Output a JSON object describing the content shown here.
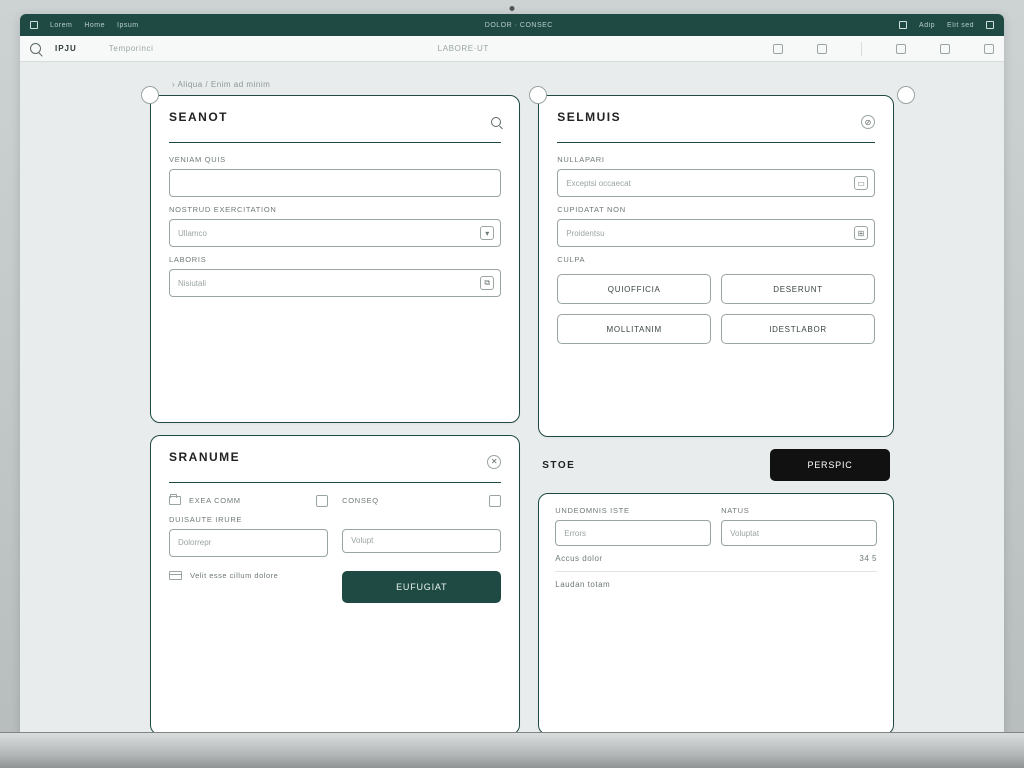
{
  "colors": {
    "accent": "#1f4a44",
    "text_muted": "#6e7977"
  },
  "tabbar": {
    "items_left": [
      "Lorem",
      "Home",
      "Ipsum"
    ],
    "center": "DOLOR · CONSEC",
    "items_right": [
      "Adip",
      "Elit sed"
    ]
  },
  "urlbar": {
    "brand": "IPJU",
    "hint_left": "Temporinci",
    "center": "LABORE·UT",
    "right_items": [
      "",
      "",
      ""
    ]
  },
  "breadcrumb": "›  Aliqua / Enim ad minim",
  "left": {
    "card1": {
      "title": "SEANOT",
      "field1": {
        "label": "VENIAM QUIS",
        "placeholder": ""
      },
      "field2": {
        "label": "NOSTRUD EXERCITATION",
        "placeholder": "Ullamco"
      },
      "field3": {
        "label": "LABORIS",
        "placeholder": "Nisiutali"
      }
    },
    "card2": {
      "title": "SRANUME",
      "row1": {
        "left_label": "EXEA COMM",
        "right_label": "CONSEQ"
      },
      "field_left": {
        "label": "DUISAUTE IRURE",
        "placeholder": "Dolorrepr"
      },
      "field_right": {
        "label": "",
        "placeholder": "Volupt"
      },
      "checkbox_label": "Velit esse cillum dolore",
      "submit_label": "EUFUGIAT"
    }
  },
  "right": {
    "card1": {
      "title": "SELMUIS",
      "field1": {
        "label": "NULLAPARI",
        "placeholder": "Exceptsi occaecat"
      },
      "field2": {
        "label": "CUPIDATAT NON",
        "placeholder": "Proidentsu"
      },
      "option_label": "CULPA",
      "opt1": "QUIOFFICIA",
      "opt2": "DESERUNT",
      "opt3": "MOLLITANIM",
      "opt4": "IDESTLABOR"
    },
    "submit_row": {
      "label": "STOE",
      "button": "PERSPIC"
    },
    "card2": {
      "label1": "UNDEOMNIS ISTE",
      "label2": "NATUS",
      "input1": "Errors",
      "input2": "Voluptat",
      "row1": {
        "left": "Accus dolor",
        "right": "34  5"
      },
      "row2": {
        "left": "Laudan totam",
        "right": ""
      }
    }
  }
}
